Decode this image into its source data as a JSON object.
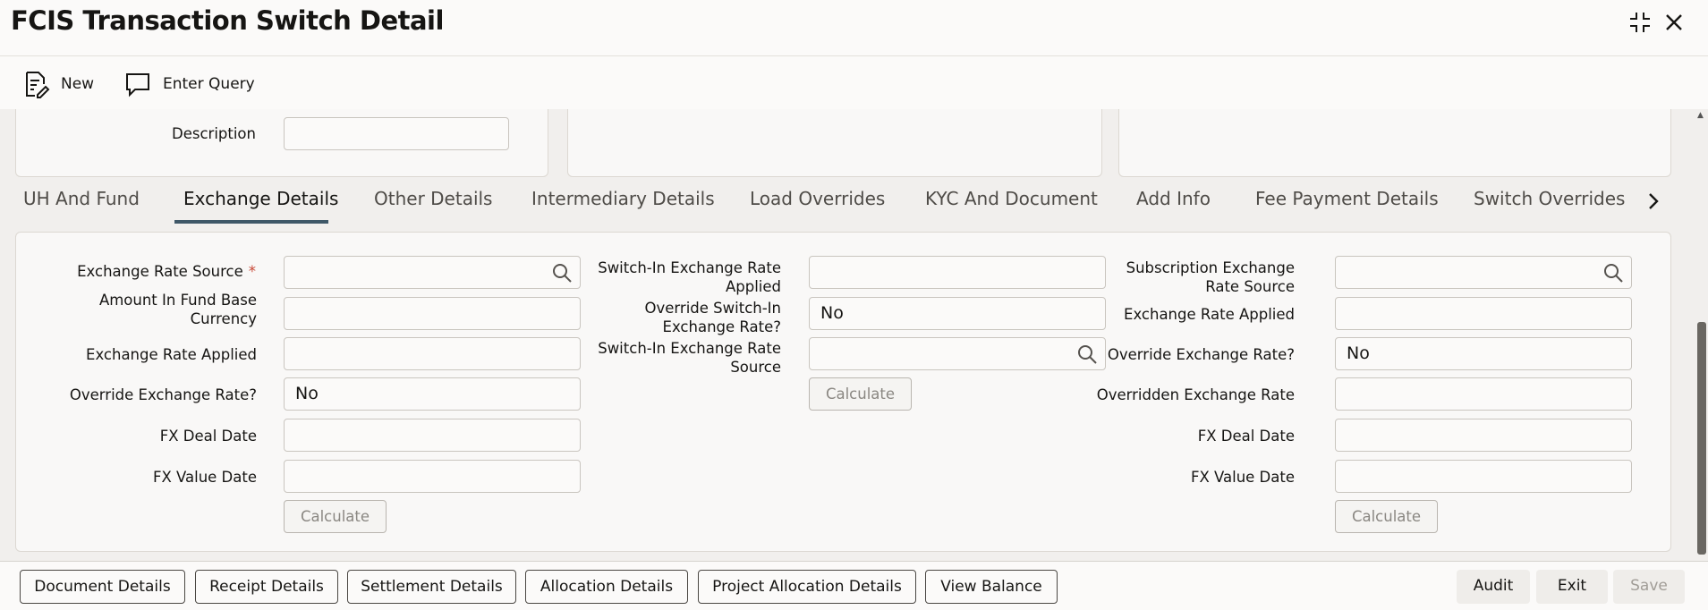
{
  "window": {
    "title": "FCIS Transaction Switch Detail"
  },
  "toolbar": {
    "new_label": "New",
    "enter_query_label": "Enter Query"
  },
  "top_section": {
    "description_label": "Description",
    "description_value": ""
  },
  "tabs": [
    {
      "label": "UH And Fund",
      "active": false
    },
    {
      "label": "Exchange Details",
      "active": true
    },
    {
      "label": "Other Details",
      "active": false
    },
    {
      "label": "Intermediary Details",
      "active": false
    },
    {
      "label": "Load Overrides",
      "active": false
    },
    {
      "label": "KYC And Document",
      "active": false
    },
    {
      "label": "Add Info",
      "active": false
    },
    {
      "label": "Fee Payment Details",
      "active": false
    },
    {
      "label": "Switch Overrides",
      "active": false
    }
  ],
  "exchange": {
    "col1": {
      "rate_source_label": "Exchange Rate Source",
      "required_mark": "*",
      "amount_label_1": "Amount In Fund Base",
      "amount_label_2": "Currency",
      "rate_applied_label": "Exchange Rate Applied",
      "override_label": "Override Exchange Rate?",
      "override_value": "No",
      "fx_deal_label": "FX Deal Date",
      "fx_value_label": "FX Value Date",
      "calculate_label": "Calculate"
    },
    "col2": {
      "rate_applied_label_1": "Switch-In Exchange Rate",
      "rate_applied_label_2": "Applied",
      "override_label_1": "Override Switch-In",
      "override_label_2": "Exchange Rate?",
      "override_value": "No",
      "rate_source_label_1": "Switch-In Exchange Rate",
      "rate_source_label_2": "Source",
      "calculate_label": "Calculate"
    },
    "col3": {
      "sub_source_label_1": "Subscription Exchange",
      "sub_source_label_2": "Rate Source",
      "rate_applied_label": "Exchange Rate Applied",
      "override_label": "Override Exchange Rate?",
      "override_value": "No",
      "overridden_label": "Overridden Exchange Rate",
      "fx_deal_label": "FX Deal Date",
      "fx_value_label": "FX Value Date",
      "calculate_label": "Calculate"
    }
  },
  "footer": {
    "document_details": "Document Details",
    "receipt_details": "Receipt Details",
    "settlement_details": "Settlement Details",
    "allocation_details": "Allocation Details",
    "project_allocation_details": "Project Allocation Details",
    "view_balance": "View Balance",
    "audit": "Audit",
    "exit": "Exit",
    "save": "Save"
  }
}
